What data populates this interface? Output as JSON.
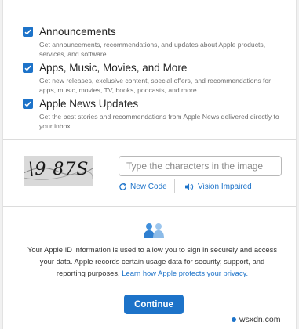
{
  "options": [
    {
      "title": "Announcements",
      "desc": "Get announcements, recommendations, and updates about Apple products, services, and software.",
      "checked": true
    },
    {
      "title": "Apps, Music, Movies, and More",
      "desc": "Get new releases, exclusive content, special offers, and recommendations for apps, music, movies, TV, books, podcasts, and more.",
      "checked": true
    },
    {
      "title": "Apple News Updates",
      "desc": "Get the best stories and recommendations from Apple News delivered directly to your inbox.",
      "checked": true
    }
  ],
  "captcha": {
    "image_text": "\\9 87S",
    "input_placeholder": "Type the characters in the image",
    "input_value": "",
    "new_code_label": "New Code",
    "vision_impaired_label": "Vision Impaired"
  },
  "privacy": {
    "text": "Your Apple ID information is used to allow you to sign in securely and access your data. Apple records certain usage data for security, support, and reporting purposes.",
    "link_text": "Learn how Apple protects your privacy."
  },
  "continue_label": "Continue",
  "watermark": "wsxdn.com",
  "colors": {
    "accent": "#1d73c9",
    "page_bg": "#f1f1f1"
  }
}
